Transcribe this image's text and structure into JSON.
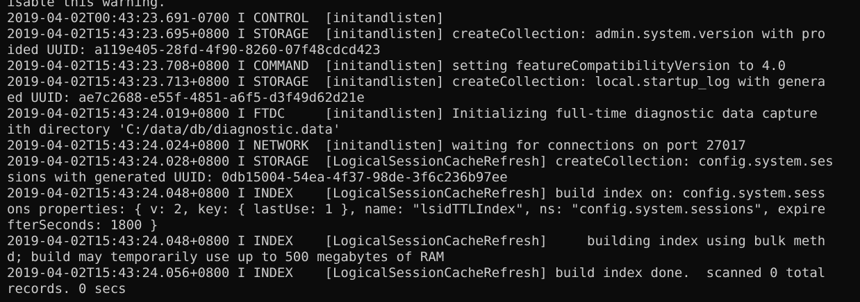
{
  "console": {
    "text_color": "#cccccc",
    "background_color": "#0c0c0c",
    "lines": [
      "isable this warning.",
      "2019-04-02T00:43:23.691-0700 I CONTROL  [initandlisten]",
      "2019-04-02T15:43:23.695+0800 I STORAGE  [initandlisten] createCollection: admin.system.version with pro",
      "ided UUID: a119e405-28fd-4f90-8260-07f48cdcd423",
      "2019-04-02T15:43:23.708+0800 I COMMAND  [initandlisten] setting featureCompatibilityVersion to 4.0",
      "2019-04-02T15:43:23.713+0800 I STORAGE  [initandlisten] createCollection: local.startup_log with genera",
      "ed UUID: ae7c2688-e55f-4851-a6f5-d3f49d62d21e",
      "2019-04-02T15:43:24.019+0800 I FTDC     [initandlisten] Initializing full-time diagnostic data capture",
      "ith directory 'C:/data/db/diagnostic.data'",
      "2019-04-02T15:43:24.024+0800 I NETWORK  [initandlisten] waiting for connections on port 27017",
      "2019-04-02T15:43:24.028+0800 I STORAGE  [LogicalSessionCacheRefresh] createCollection: config.system.ses",
      "sions with generated UUID: 0db15004-54ea-4f37-98de-3f6c236b97ee",
      "2019-04-02T15:43:24.048+0800 I INDEX    [LogicalSessionCacheRefresh] build index on: config.system.sess",
      "ons properties: { v: 2, key: { lastUse: 1 }, name: \"lsidTTLIndex\", ns: \"config.system.sessions\", expire",
      "fterSeconds: 1800 }",
      "2019-04-02T15:43:24.048+0800 I INDEX    [LogicalSessionCacheRefresh]     building index using bulk meth",
      "d; build may temporarily use up to 500 megabytes of RAM",
      "2019-04-02T15:43:24.056+0800 I INDEX    [LogicalSessionCacheRefresh] build index done.  scanned 0 total",
      "records. 0 secs"
    ]
  }
}
